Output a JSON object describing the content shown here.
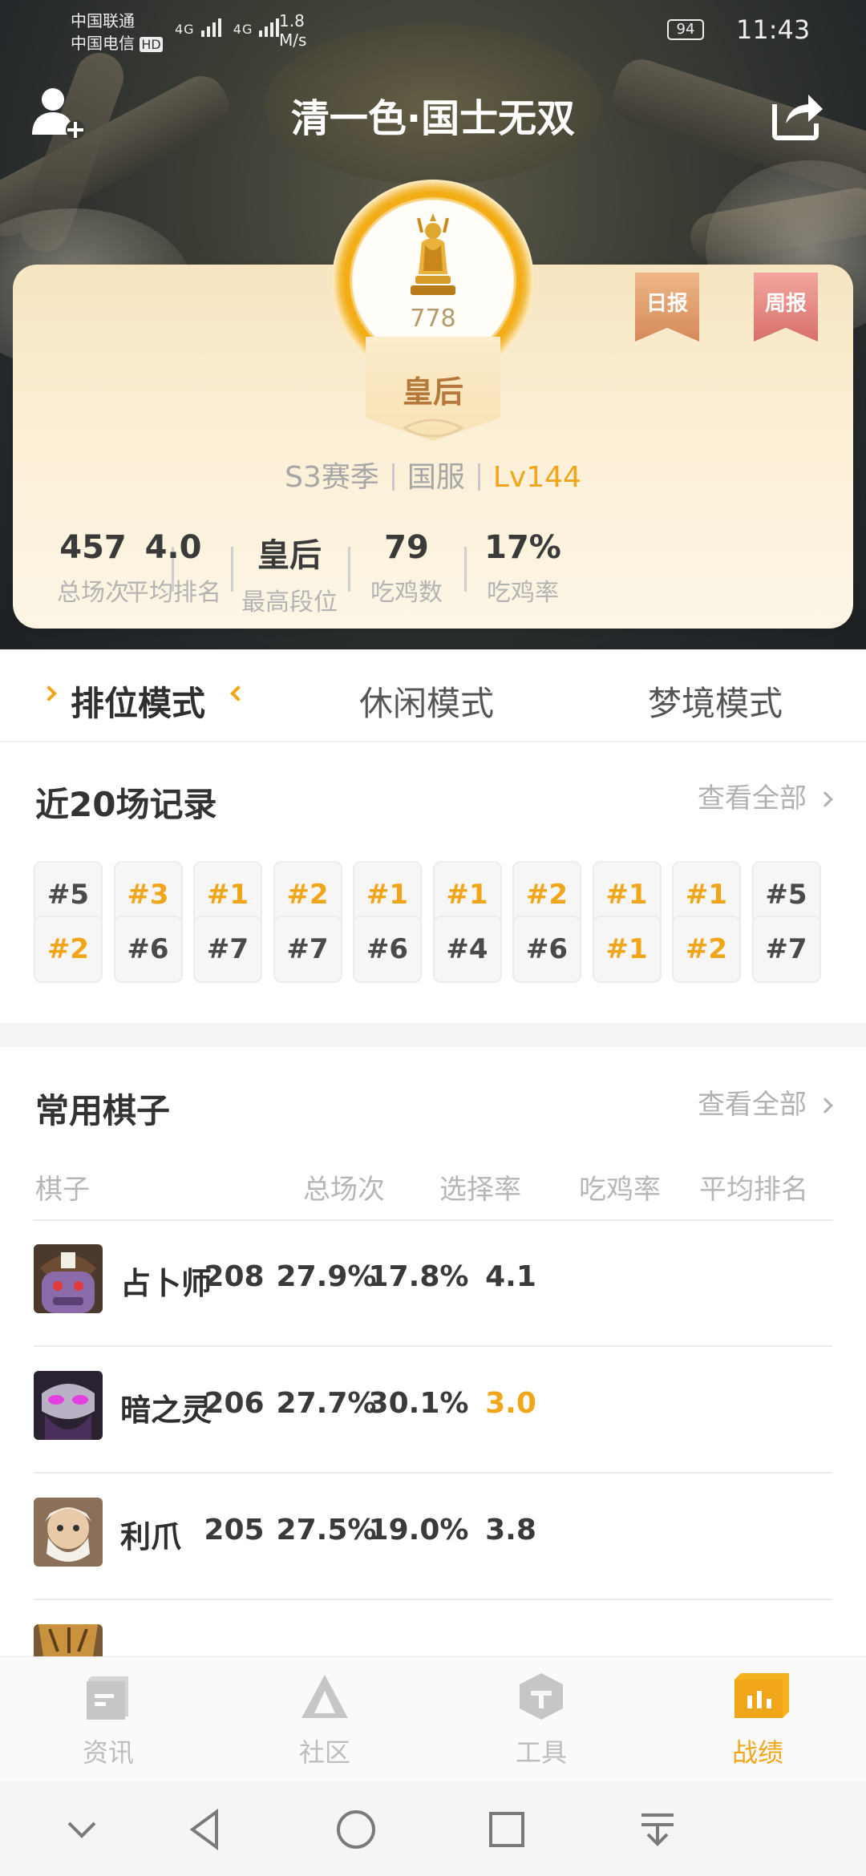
{
  "status_bar": {
    "carrier_1": "中国联通",
    "carrier_2": "中国电信",
    "hd": "HD",
    "signal_1": "4G",
    "signal_2": "4G",
    "speed_value": "1.8",
    "speed_unit": "M/s",
    "battery": "94",
    "time": "11:43"
  },
  "header": {
    "title": "清一色·国士无双"
  },
  "profile": {
    "medal_score": "778",
    "rank_name": "皇后",
    "daily_badge": "日报",
    "weekly_badge": "周报",
    "season": "S3赛季",
    "server": "国服",
    "level": "Lv144"
  },
  "stats": [
    {
      "value": "457",
      "label": "总场次"
    },
    {
      "value": "4.0",
      "label": "平均排名"
    },
    {
      "value": "皇后",
      "label": "最高段位"
    },
    {
      "value": "79",
      "label": "吃鸡数"
    },
    {
      "value": "17%",
      "label": "吃鸡率"
    }
  ],
  "modes": {
    "ranked": "排位模式",
    "casual": "休闲模式",
    "dream": "梦境模式",
    "selected": "排位模式"
  },
  "records": {
    "title": "近20场记录",
    "view_all": "查看全部",
    "items": [
      "#5",
      "#3",
      "#1",
      "#2",
      "#1",
      "#1",
      "#2",
      "#1",
      "#1",
      "#5",
      "#2",
      "#6",
      "#7",
      "#7",
      "#6",
      "#4",
      "#6",
      "#1",
      "#2",
      "#7"
    ]
  },
  "chess": {
    "title": "常用棋子",
    "view_all": "查看全部",
    "columns": [
      "棋子",
      "总场次",
      "选择率",
      "吃鸡率",
      "平均排名"
    ],
    "rows": [
      {
        "name": "占卜师",
        "games": "208",
        "pick": "27.9%",
        "win": "17.8%",
        "avg": "4.1"
      },
      {
        "name": "暗之灵",
        "games": "206",
        "pick": "27.7%",
        "win": "30.1%",
        "avg": "3.0"
      },
      {
        "name": "利爪",
        "games": "205",
        "pick": "27.5%",
        "win": "19.0%",
        "avg": "3.8"
      }
    ]
  },
  "bottom_nav": [
    {
      "label": "资讯",
      "icon": "news-icon"
    },
    {
      "label": "社区",
      "icon": "community-icon"
    },
    {
      "label": "工具",
      "icon": "tools-icon"
    },
    {
      "label": "战绩",
      "icon": "record-icon"
    }
  ],
  "colors": {
    "accent": "#f1a518",
    "card_bg": "#fbeed3",
    "rank_text": "#b5783a"
  }
}
